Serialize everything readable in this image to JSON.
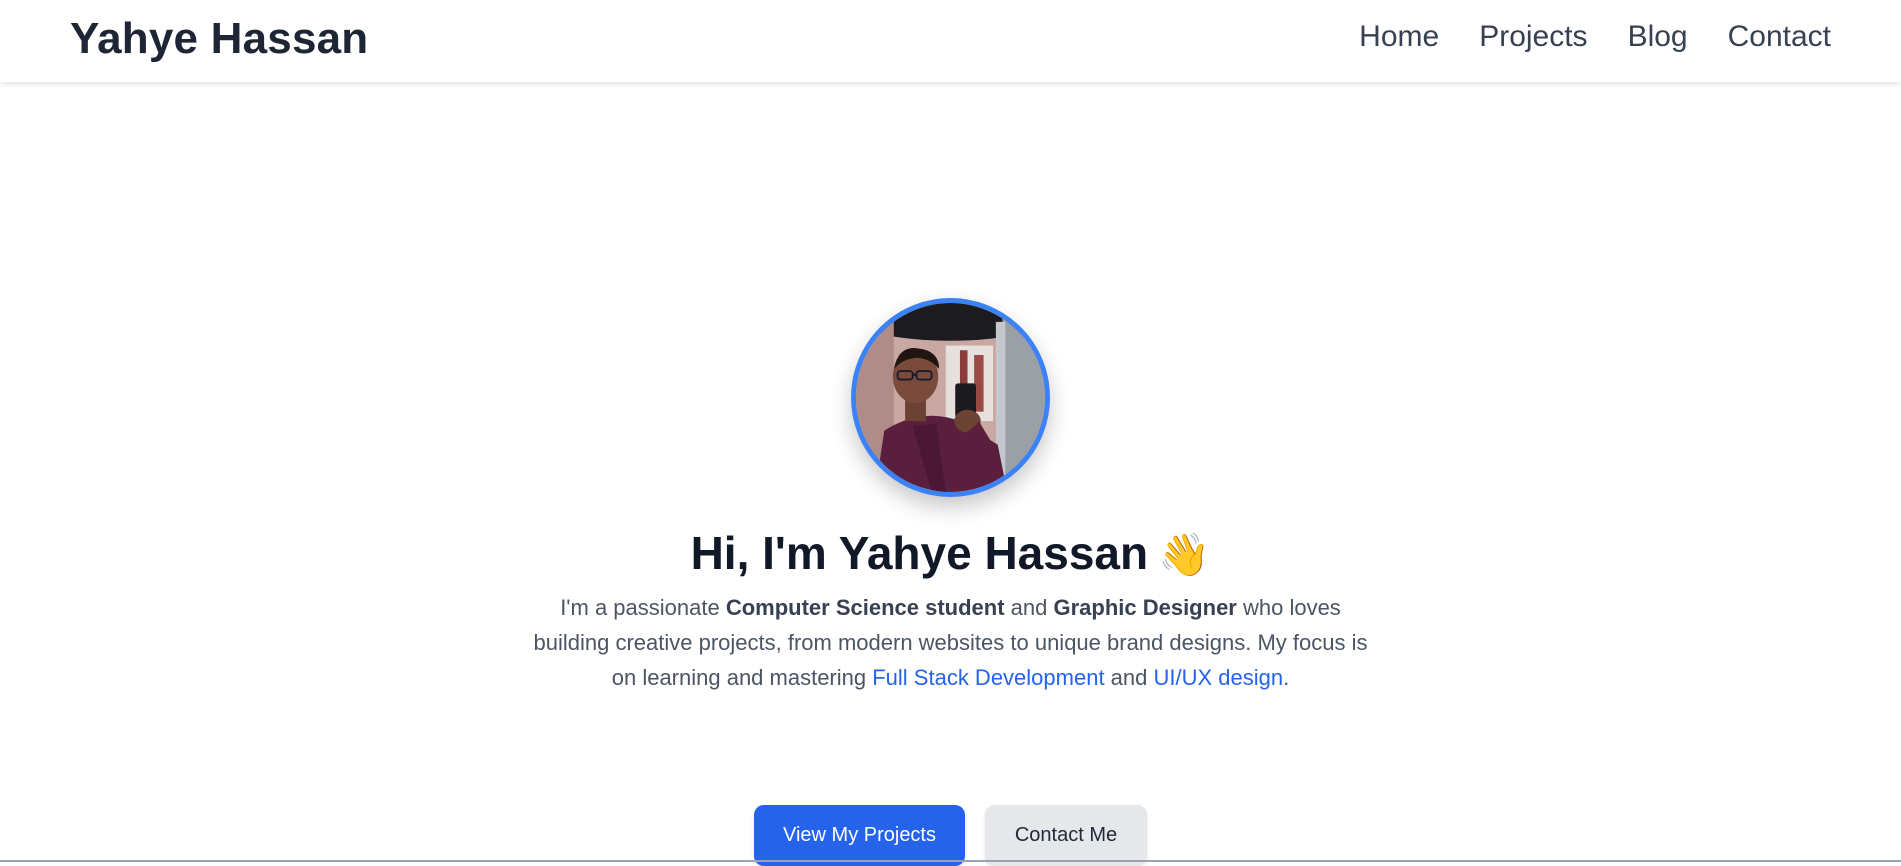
{
  "navbar": {
    "brand": "Yahye Hassan",
    "links": [
      {
        "label": "Home"
      },
      {
        "label": "Projects"
      },
      {
        "label": "Blog"
      },
      {
        "label": "Contact"
      }
    ]
  },
  "hero": {
    "avatar_icon": "profile-photo",
    "title": "Hi, I'm Yahye Hassan",
    "wave_emoji": "👋",
    "description": {
      "p1": "I'm a passionate ",
      "strong1": "Computer Science student",
      "p2": " and ",
      "strong2": "Graphic Designer",
      "p3": " who loves building creative projects, from modern websites to unique brand designs. My focus is on learning and mastering ",
      "accent1": "Full Stack Development",
      "p4": " and ",
      "accent2": "UI/UX design",
      "p5": "."
    },
    "buttons": {
      "primary": "View My Projects",
      "secondary": "Contact Me"
    }
  },
  "colors": {
    "accent": "#2563eb",
    "avatar_ring": "#3b82f6",
    "heading": "#111827",
    "body_text": "#4b5563",
    "secondary_button_bg": "#e5e7eb"
  }
}
